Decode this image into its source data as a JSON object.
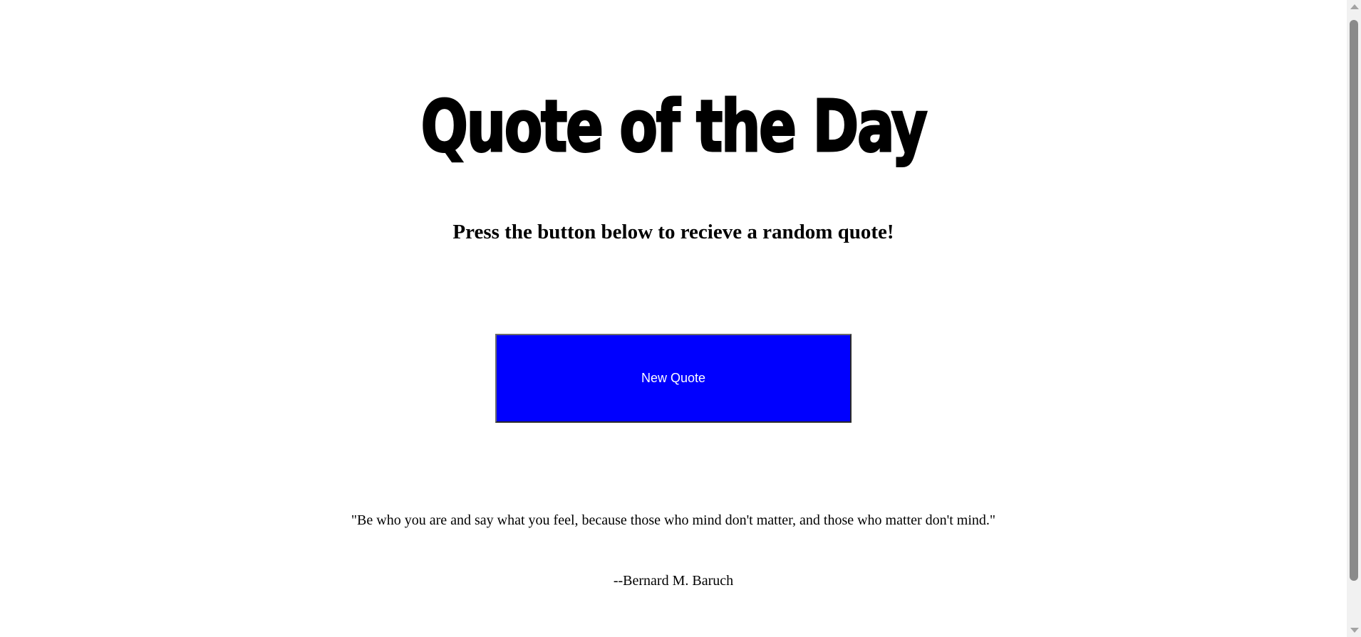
{
  "page": {
    "title": "Quote of the Day",
    "subtitle": "Press the button below to recieve a random quote!"
  },
  "button": {
    "label": "New Quote",
    "color": "#0000ff"
  },
  "quote": {
    "text": "\"Be who you are and say what you feel, because those who mind don't matter, and those who matter don't mind.\"",
    "author": "--Bernard M. Baruch"
  }
}
